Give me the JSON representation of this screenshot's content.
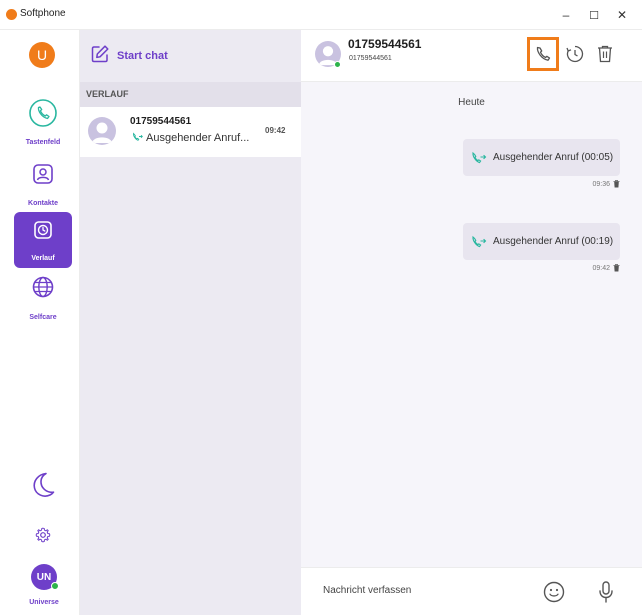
{
  "window": {
    "title": "Softphone",
    "controls": {
      "minimize": "–",
      "maximize": "☐",
      "close": "✕"
    }
  },
  "rail": {
    "account_initial": "U",
    "items": [
      {
        "id": "tastenfeld",
        "label": "Tastenfeld",
        "icon": "phone-icon"
      },
      {
        "id": "kontakte",
        "label": "Kontakte",
        "icon": "contact-icon"
      },
      {
        "id": "verlauf",
        "label": "Verlauf",
        "icon": "clock-icon",
        "active": true
      },
      {
        "id": "selfcare",
        "label": "Selfcare",
        "icon": "globe-icon"
      }
    ],
    "user": {
      "initials": "UN",
      "label": "Universe",
      "status": "online"
    }
  },
  "list": {
    "start_chat_label": "Start chat",
    "section_label": "VERLAUF",
    "items": [
      {
        "name": "01759544561",
        "time": "09:42",
        "last_message": "Ausgehender Anruf..."
      }
    ]
  },
  "conversation": {
    "contact_name": "01759544561",
    "contact_number": "01759544561",
    "day_label": "Heute",
    "messages": [
      {
        "text": "Ausgehender Anruf (00:05)",
        "time": "09:36"
      },
      {
        "text": "Ausgehender Anruf (00:19)",
        "time": "09:42"
      }
    ],
    "composer_placeholder": "Nachricht verfassen"
  },
  "colors": {
    "accent": "#6e3fc9",
    "brand": "#f07c1a",
    "call_icon": "#2ab7a0",
    "online": "#2db34a"
  }
}
